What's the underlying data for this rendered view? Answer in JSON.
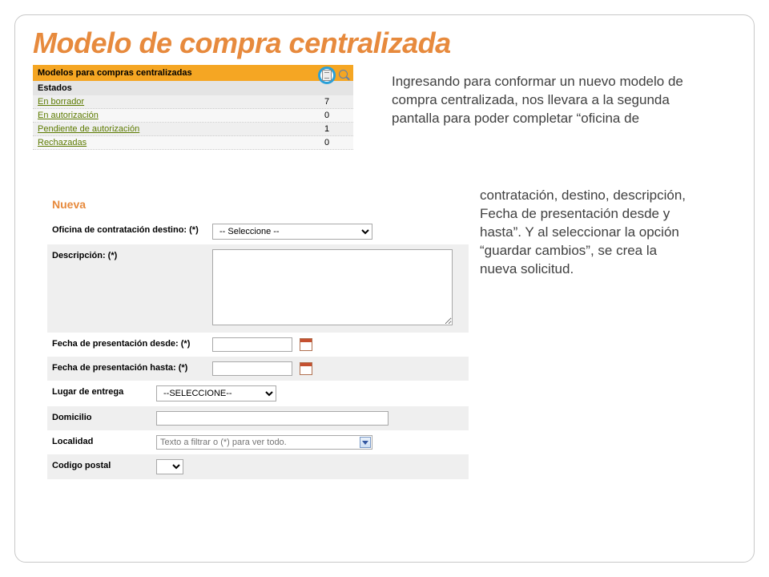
{
  "title": "Modelo de compra centralizada",
  "status_panel": {
    "header": "Modelos para compras centralizadas",
    "subheader": "Estados",
    "rows": [
      {
        "label": "En borrador",
        "count": "7"
      },
      {
        "label": "En autorización",
        "count": "0"
      },
      {
        "label": "Pendiente de autorización",
        "count": "1"
      },
      {
        "label": "Rechazadas",
        "count": "0"
      }
    ]
  },
  "description_part1": "Ingresando para conformar un nuevo modelo de compra centralizada, nos llevara a la segunda pantalla para poder completar “oficina de",
  "description_part2": "contratación, destino, descripción, Fecha de presentación desde y hasta”. Y al seleccionar la opción “guardar cambios”, se crea la nueva solicitud.",
  "form": {
    "title": "Nueva",
    "labels": {
      "oficina": "Oficina de contratación destino: (*)",
      "descripcion": "Descripción: (*)",
      "fecha_desde": "Fecha de presentación desde: (*)",
      "fecha_hasta": "Fecha de presentación hasta: (*)",
      "lugar": "Lugar de entrega",
      "domicilio": "Domicilio",
      "localidad": "Localidad",
      "codigo_postal": "Codigo postal"
    },
    "oficina_placeholder": "-- Seleccione --",
    "lugar_placeholder": "--SELECCIONE--",
    "localidad_placeholder": "Texto a filtrar o (*) para ver todo."
  }
}
